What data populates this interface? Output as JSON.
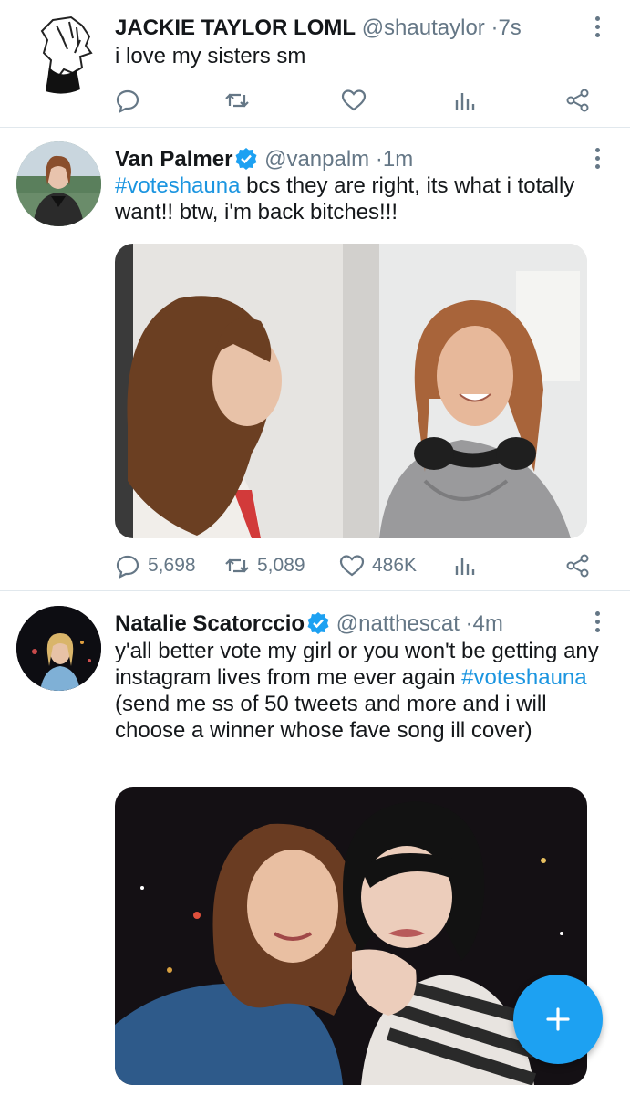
{
  "colors": {
    "accent": "#1da1f2",
    "hashtag": "#1b95e0",
    "muted": "#657786",
    "text": "#14171a"
  },
  "tweets": [
    {
      "display_name": "JACKIE TAYLOR LOML",
      "handle": "@shautaylor",
      "separator": "·",
      "time": "7s",
      "verified": false,
      "text": "i love my sisters sm",
      "replies": "",
      "retweets": "",
      "likes": ""
    },
    {
      "display_name": "Van Palmer",
      "handle": "@vanpalm",
      "separator": "·",
      "time": "1m",
      "verified": true,
      "hashtag": "#voteshauna",
      "text": " bcs they are right, its what i totally want!! btw, i'm back bitches!!!",
      "replies": "5,698",
      "retweets": "5,089",
      "likes": "486K"
    },
    {
      "display_name": "Natalie Scatorccio",
      "handle": "@natthescat",
      "separator": "·",
      "time": "4m",
      "verified": true,
      "text_before": "y'all better vote my girl or you won't be getting any instagram lives from me ever again ",
      "hashtag": "#voteshauna",
      "text_after": " (send me ss of 50 tweets and more and i will choose a winner whose fave song ill cover)"
    }
  ],
  "icons": {
    "reply": "reply-icon",
    "retweet": "retweet-icon",
    "like": "heart-icon",
    "analytics": "analytics-icon",
    "share": "share-icon",
    "more": "more-options-icon",
    "verified": "verified-badge-icon",
    "compose": "plus-icon"
  }
}
